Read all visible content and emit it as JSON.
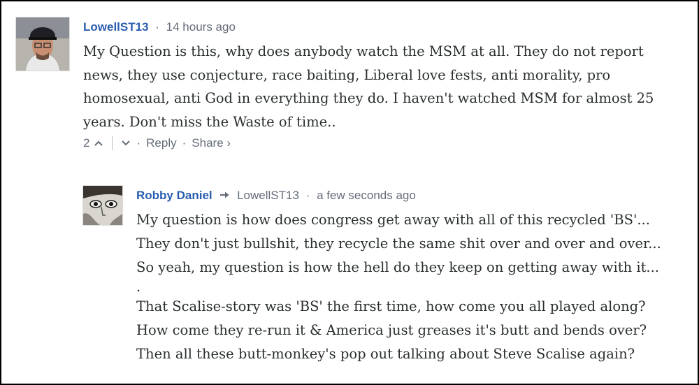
{
  "comments": [
    {
      "author": "LowellST13",
      "time": "14 hours ago",
      "lines": [
        "My Question is this, why does anybody watch the MSM at all. They do not report",
        "news, they use conjecture, race baiting, Liberal love fests, anti morality, pro",
        "homosexual, anti God in everything they do. I haven't watched MSM for almost 25",
        "years. Don't miss the Waste of time.."
      ],
      "votes": "2",
      "upvote_icon": "chevron-up-icon",
      "downvote_icon": "chevron-down-icon",
      "reply_label": "Reply",
      "share_label": "Share ›"
    },
    {
      "author": "Robby Daniel",
      "reply_to": "LowellST13",
      "time": "a few seconds ago",
      "lines": [
        "My question is how does congress get away with all of this recycled 'BS'...",
        "They don't just bullshit, they recycle the same shit over and over and over...",
        "So yeah, my question is how the hell do they keep on getting away with it...",
        ".",
        "That Scalise-story was 'BS' the first time, how come you all played along?",
        "How come they re-run it & America just greases it's butt and bends over?",
        "Then all these butt-monkey's pop out talking about Steve Scalise again?"
      ]
    }
  ],
  "icons": {
    "reply_arrow": "reply-arrow-icon"
  }
}
